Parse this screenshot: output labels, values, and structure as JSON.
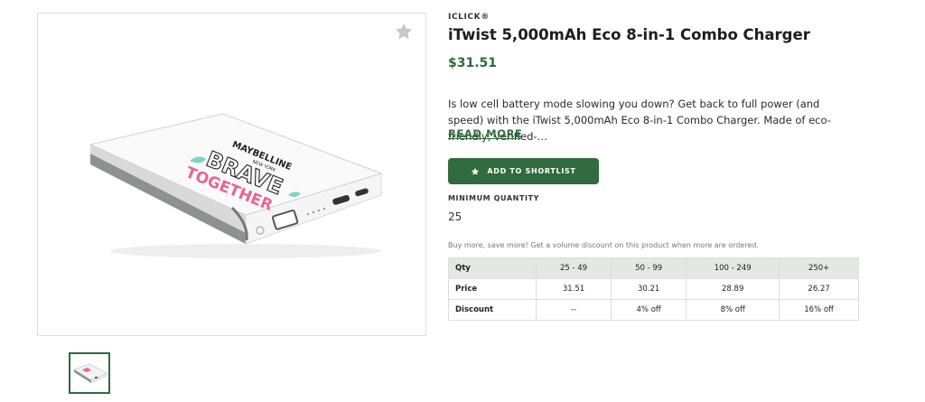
{
  "product": {
    "brand": "ICLICK®",
    "title": "iTwist 5,000mAh Eco 8-in-1 Combo Charger",
    "price": "$31.51",
    "description": "Is low cell battery mode slowing you down? Get back to full power (and speed) with the iTwist 5,000mAh Eco 8-in-1 Combo Charger. Made of eco-friendly, verified-…",
    "read_more": "READ MORE",
    "printed_text": [
      "MAYBELLINE",
      "NEW YORK",
      "BRAVE",
      "TOGETHER"
    ]
  },
  "actions": {
    "shortlist_label": "ADD TO SHORTLIST",
    "shortlist_icon": "star-icon",
    "favorite_icon": "star-outline-icon"
  },
  "quantity": {
    "label": "MINIMUM QUANTITY",
    "value": "25"
  },
  "volume": {
    "note": "Buy more, save more! Get a volume discount on this product when more are ordered.",
    "headers": [
      "Qty",
      "25 - 49",
      "50 - 99",
      "100 - 249",
      "250+"
    ],
    "rows": [
      [
        "Price",
        "31.51",
        "30.21",
        "28.89",
        "26.27"
      ],
      [
        "Discount",
        "--",
        "4% off",
        "8% off",
        "16% off"
      ]
    ]
  },
  "colors": {
    "accent": "#2f6b3d",
    "table_header_bg": "#e2e8e4"
  }
}
